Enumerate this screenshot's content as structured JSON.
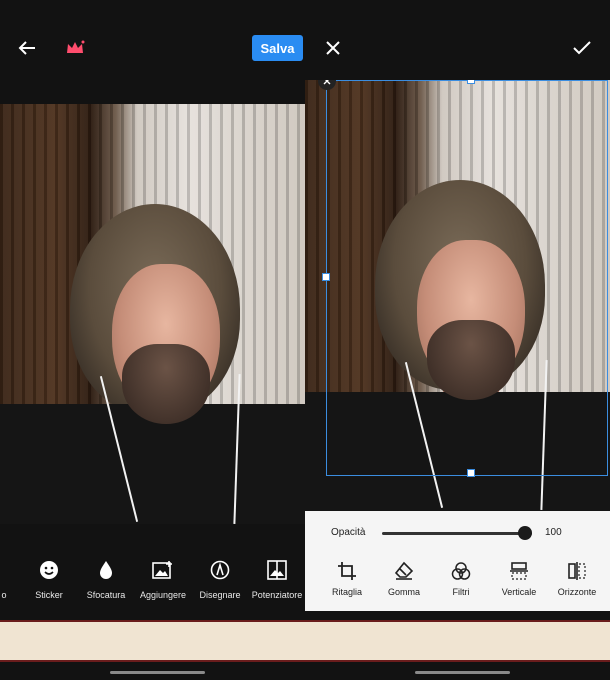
{
  "left": {
    "save_label": "Salva",
    "tools": [
      {
        "label": "o",
        "icon": "partial-tool-icon"
      },
      {
        "label": "Sticker",
        "icon": "sticker-icon"
      },
      {
        "label": "Sfocatura",
        "icon": "blur-drop-icon"
      },
      {
        "label": "Aggiungere",
        "icon": "add-image-icon"
      },
      {
        "label": "Disegnare",
        "icon": "draw-icon"
      },
      {
        "label": "Potenziatore",
        "icon": "enhance-icon"
      }
    ]
  },
  "right": {
    "opacity_label": "Opacità",
    "opacity_value": "100",
    "opacity_level": 1.0,
    "tools": [
      {
        "label": "Ritaglia",
        "icon": "crop-icon"
      },
      {
        "label": "Gomma",
        "icon": "eraser-icon"
      },
      {
        "label": "Filtri",
        "icon": "filters-icon"
      },
      {
        "label": "Verticale",
        "icon": "flip-vertical-icon"
      },
      {
        "label": "Orizzonte",
        "icon": "flip-horizontal-icon"
      }
    ]
  },
  "colors": {
    "accent": "#2a8cf2",
    "crop_border": "#3b8de0",
    "crown": "#ff4d6d"
  }
}
